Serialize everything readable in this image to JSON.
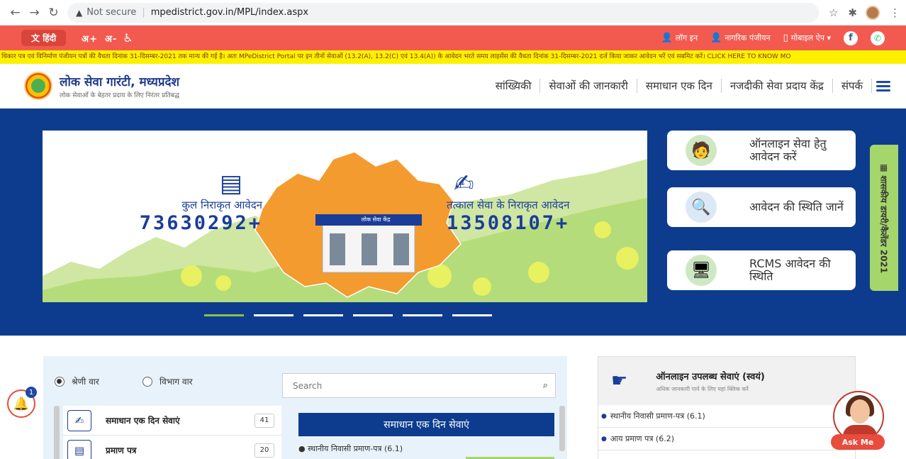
{
  "browser": {
    "security": "Not secure",
    "url": "mpedistrict.gov.in/MPL/index.aspx"
  },
  "topbar": {
    "language": "हिंदी",
    "font_increase": "अ+",
    "font_decrease": "अ-",
    "links": [
      {
        "label": "लॉग इन",
        "icon": "user-plus-icon"
      },
      {
        "label": "नागरिक पंजीयन",
        "icon": "user-icon"
      },
      {
        "label": "मोबाइल ऐप ▾",
        "icon": "mobile-icon"
      }
    ],
    "colors": {
      "bar": "#f35a4f",
      "ticker": "#fdf100"
    }
  },
  "ticker": "धिकार पत्र एवं विनिर्माण पंजीयन पत्रों की वैधता दिनांक 31-दिसम्बर-2021 तक मान्य की गई है। अतः MPeDistrict Portal पर इन तीनों सेवाओं (13.2(A), 13.2(C) एवं 13.4(A)) के आवेदन भरते समय लाइसेंस की वैधता दिनांक 31-दिसम्बर-2021 दर्ज किया जाकर आवेदन भरें एवं सबमिट करें। CLICK HERE TO KNOW MO",
  "header": {
    "title": "लोक सेवा गारंटी, मध्यप्रदेश",
    "subtitle": "लोक सेवाओं के बेहतर प्रदाय के लिए निरंतर प्रतिबद्ध",
    "menu": [
      "सांख्यिकी",
      "सेवाओं की जानकारी",
      "समाधान एक दिन",
      "नजदीकी सेवा प्रदाय केंद्र",
      "संपर्क"
    ]
  },
  "hero": {
    "stat1": {
      "label": "कुल निराकृत आवेदन",
      "value": "73630292+"
    },
    "stat2": {
      "label": "तत्काल सेवा के निराकृत आवेदन",
      "value": "13508107+"
    },
    "building_sign": "लोक सेवा केंद्र",
    "slides": 6,
    "active_slide": 1,
    "cards": [
      {
        "label": "ऑनलाइन सेवा हेतु आवेदन करें",
        "icon": "online-apply-icon"
      },
      {
        "label": "आवेदन की स्थिति जानें",
        "icon": "status-search-icon"
      },
      {
        "label": "RCMS आवेदन की स्थिति",
        "icon": "rcms-monitor-icon"
      }
    ],
    "side_tab": "शासकीय डायरी/कैलेंडर 2021"
  },
  "services": {
    "filter_options": [
      "श्रेणी वार",
      "विभाग वार"
    ],
    "selected_filter": "श्रेणी वार",
    "search_placeholder": "Search",
    "categories": [
      {
        "name": "समाधान एक दिन सेवाएं",
        "count": "41"
      },
      {
        "name": "प्रमाण पत्र",
        "count": "20"
      }
    ],
    "selected_heading": "समाधान एक दिन सेवाएं",
    "first_item": "स्थानीय निवासी प्रमाण-पत्र (6.1)"
  },
  "notification_count": "1",
  "online_panel": {
    "title": "ऑनलाइन उपलब्ध सेवाएं (स्वयं)",
    "subtitle": "अधिक जानकारी पाने के लिए यहां क्लिक करें",
    "items": [
      "स्थानीय निवासी प्रमाण-पत्र (6.1)",
      "आय प्रमाण पत्र (6.2)"
    ]
  },
  "chatbot": "Ask Me"
}
